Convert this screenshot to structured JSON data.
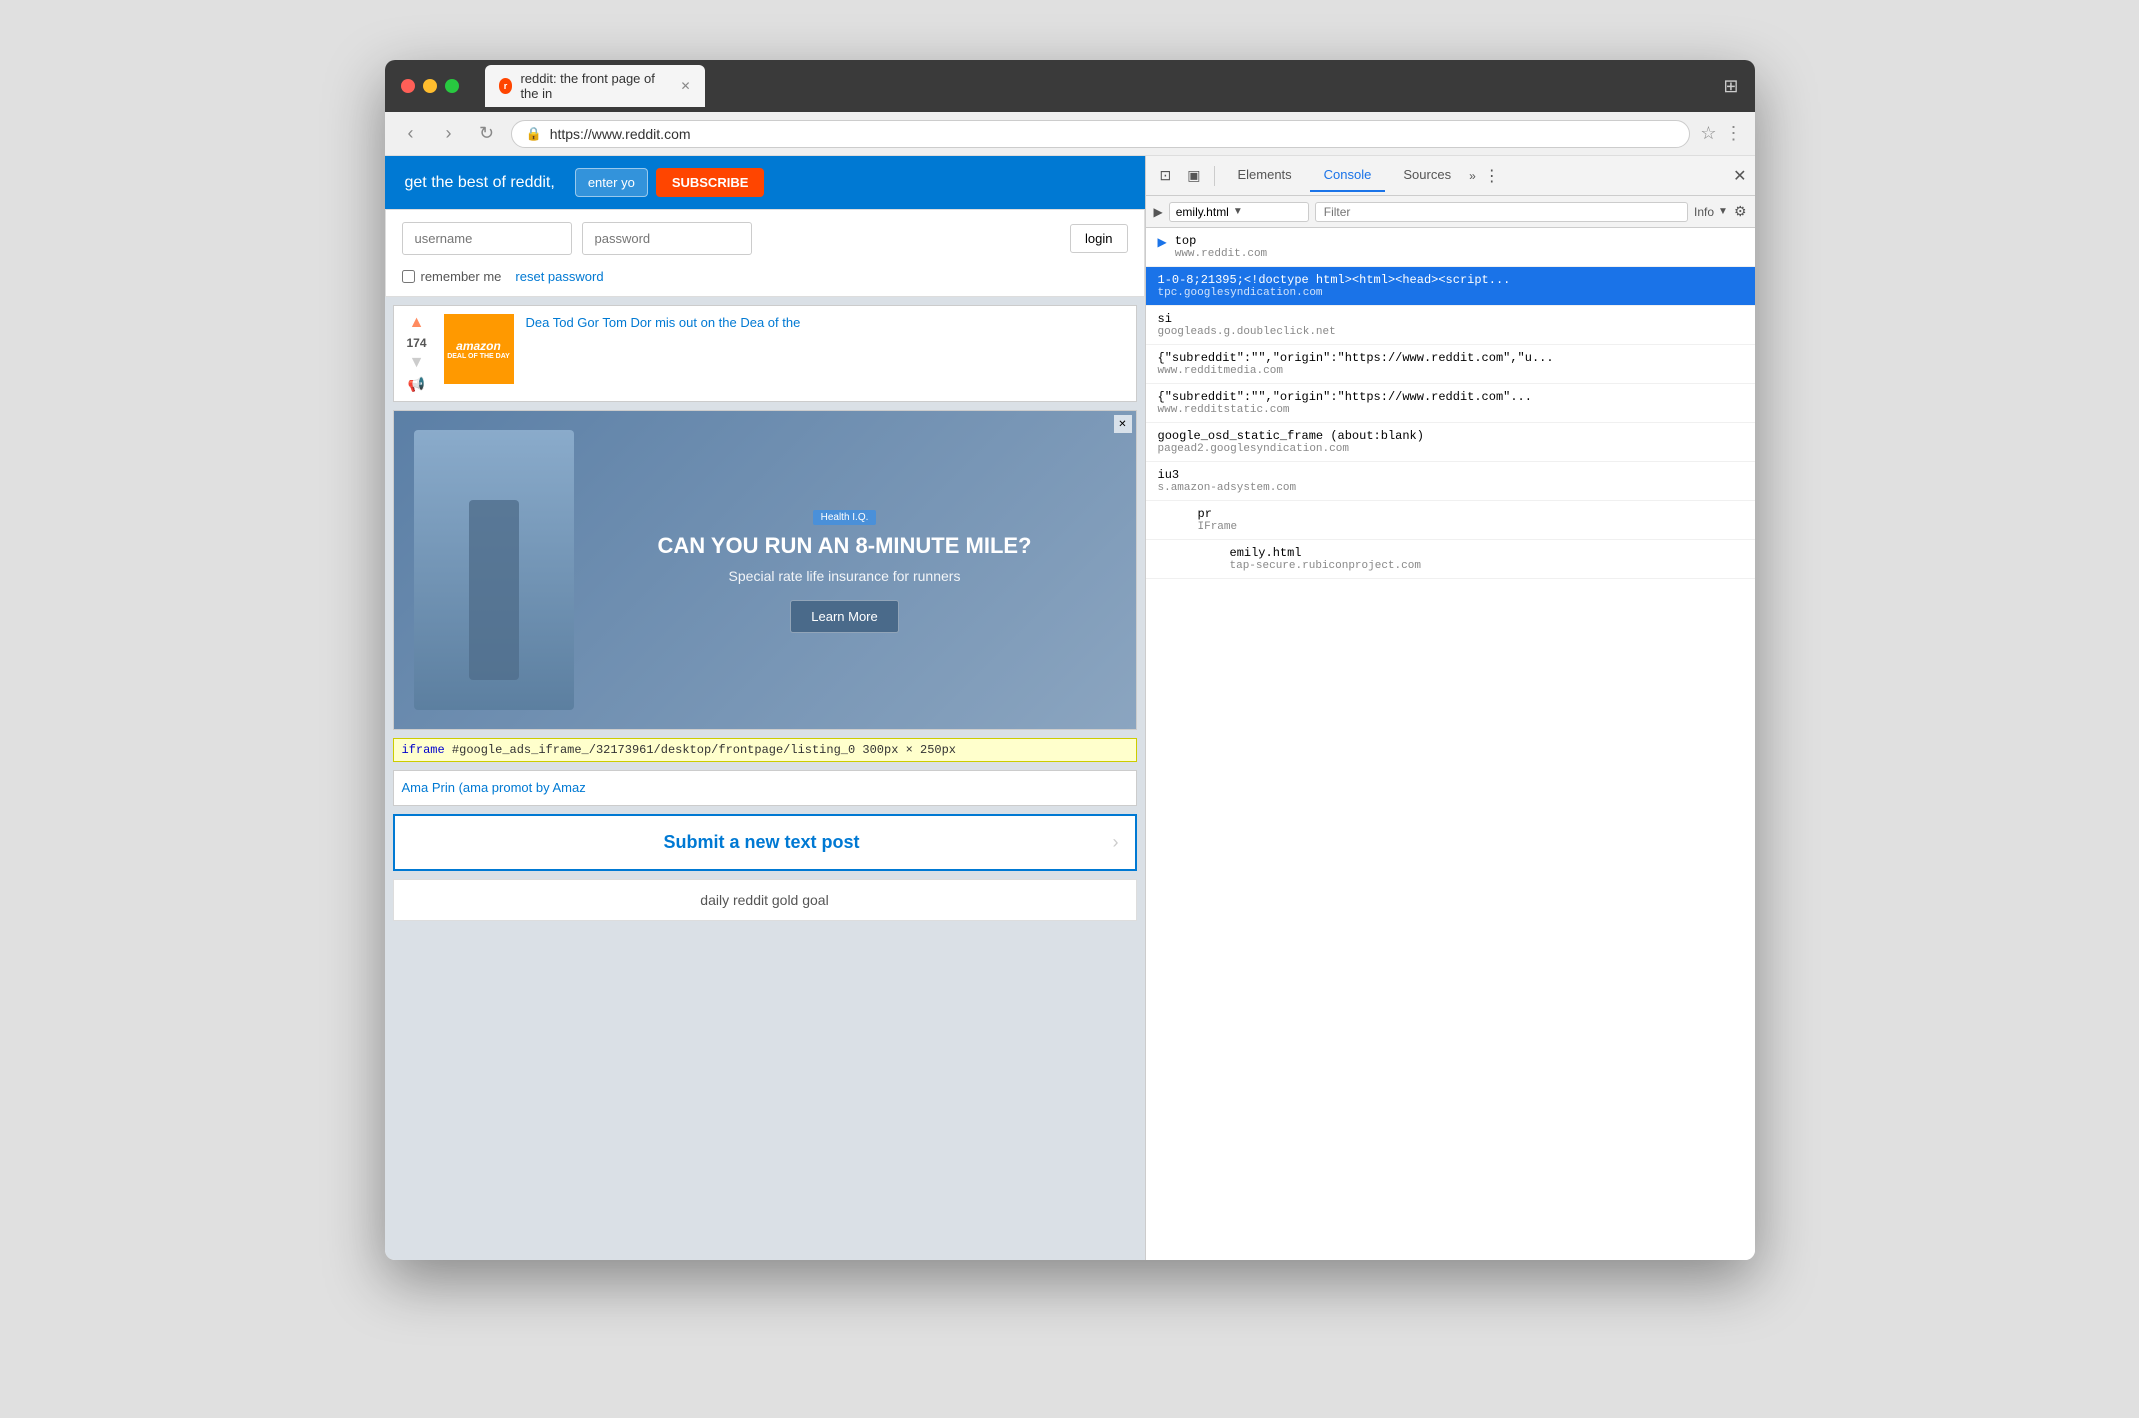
{
  "browser": {
    "tab_title": "reddit: the front page of the in",
    "tab_favicon": "r",
    "url": "https://www.reddit.com",
    "devtools_icon": "⚙"
  },
  "reddit": {
    "header_text": "get the best of reddit,",
    "enter_placeholder": "enter yo",
    "subscribe_label": "SUBSCRIBE",
    "login": {
      "username_placeholder": "username",
      "password_placeholder": "password",
      "remember_label": "remember me",
      "reset_link": "reset password",
      "login_btn": "login"
    },
    "post": {
      "vote_count": "174",
      "title_lines": "Dea Tod Gor Tom Dor mis out on the Dea of the"
    },
    "ad": {
      "badge": "Health I.Q.",
      "headline": "CAN YOU RUN AN 8-MINUTE MILE?",
      "subtext": "Special rate life insurance for runners",
      "learn_btn": "Learn More"
    },
    "iframe_label": "iframe",
    "iframe_id": "#google_ads_iframe_/32173961/desktop/frontpage/listing_0",
    "iframe_size": "300px × 250px",
    "amazon_promo_title": "Ama Prin",
    "amazon_promo_sub": "(ama promot by Amaz",
    "submit_post_label": "Submit a new text post",
    "gold_goal_label": "daily reddit gold goal"
  },
  "devtools": {
    "tabs": [
      "Elements",
      "Console",
      "Sources"
    ],
    "active_tab": "Console",
    "more_tabs": "»",
    "context_selector": "emily.html",
    "filter_placeholder": "Filter",
    "log_level": "Info",
    "console_items": [
      {
        "indent": 0,
        "has_arrow": true,
        "arrow_selected": false,
        "main": "top",
        "domain": "www.reddit.com",
        "selected": false
      },
      {
        "indent": 0,
        "has_arrow": false,
        "main": "1-0-8;21395;<doctype html><html><head><script...",
        "domain": "tpc.googlesyndication.com",
        "selected": true
      },
      {
        "indent": 0,
        "has_arrow": false,
        "main": "si",
        "domain": "googleads.g.doubleclick.net",
        "selected": false
      },
      {
        "indent": 0,
        "has_arrow": false,
        "main": "{\"subreddit\":\"\",\"origin\":\"https://www.reddit.com\",\"u...",
        "domain": "www.redditmedia.com",
        "selected": false
      },
      {
        "indent": 0,
        "has_arrow": false,
        "main": "{\"subreddit\":\"\",\"origin\":\"https://www.reddit.com\"...",
        "domain": "www.redditstatic.com",
        "selected": false
      },
      {
        "indent": 0,
        "has_arrow": false,
        "main": "google_osd_static_frame (about:blank)",
        "domain": "pagead2.googlesyndication.com",
        "selected": false
      },
      {
        "indent": 0,
        "has_arrow": false,
        "main": "iu3",
        "domain": "s.amazon-adsystem.com",
        "selected": false
      },
      {
        "indent": 1,
        "has_arrow": false,
        "main": "pr",
        "domain": "IFrame",
        "selected": false
      },
      {
        "indent": 2,
        "has_arrow": false,
        "main": "emily.html",
        "domain": "tap-secure.rubiconproject.com",
        "selected": false
      }
    ]
  }
}
